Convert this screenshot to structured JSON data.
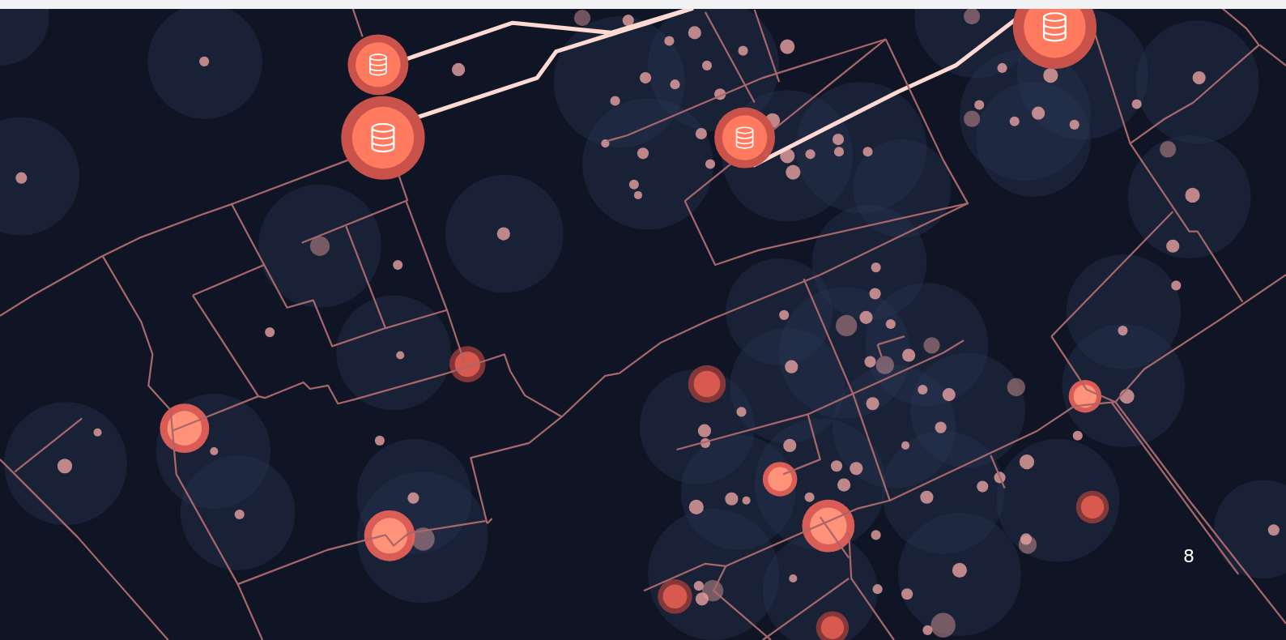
{
  "map": {
    "cluster_label": "8"
  }
}
